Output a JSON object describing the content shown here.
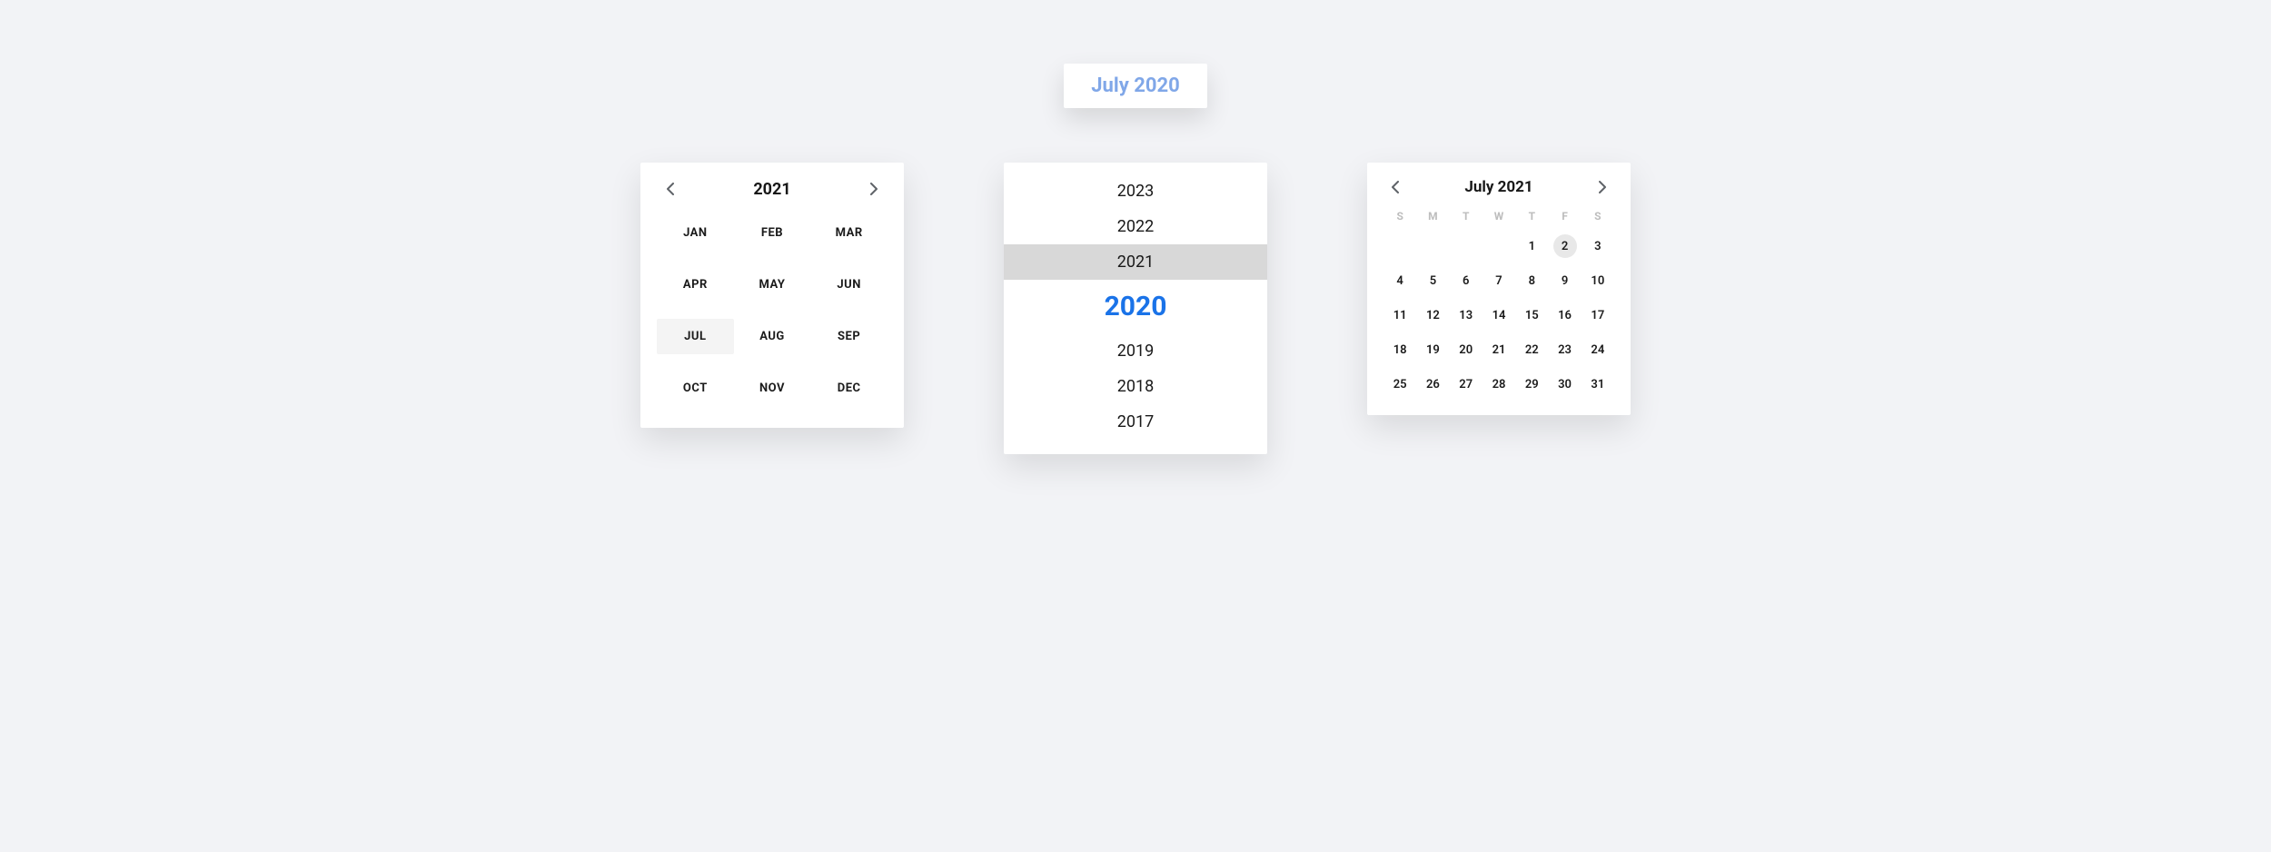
{
  "chip": {
    "label": "July 2020"
  },
  "monthPicker": {
    "year": "2021",
    "months": [
      "JAN",
      "FEB",
      "MAR",
      "APR",
      "MAY",
      "JUN",
      "JUL",
      "AUG",
      "SEP",
      "OCT",
      "NOV",
      "DEC"
    ],
    "selectedIndex": 6
  },
  "yearPicker": {
    "years": [
      "2023",
      "2022",
      "2021",
      "2020",
      "2019",
      "2018",
      "2017"
    ],
    "highlightIndex": 2,
    "activeIndex": 3
  },
  "dayPicker": {
    "title": "July 2021",
    "weekdays": [
      "S",
      "M",
      "T",
      "W",
      "T",
      "F",
      "S"
    ],
    "blanks": 4,
    "daysInMonth": 31,
    "selectedDay": 2
  }
}
